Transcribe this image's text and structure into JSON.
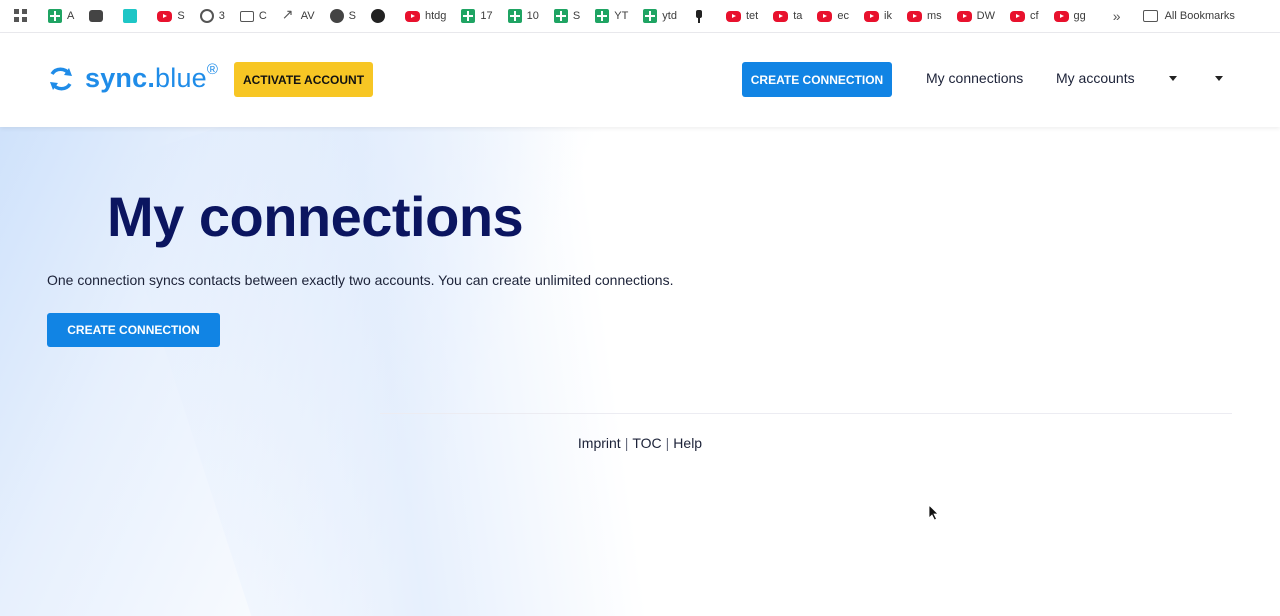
{
  "bookmarks": {
    "items": [
      {
        "icon": "sheets-icon",
        "label": "A"
      },
      {
        "icon": "puzzle-icon",
        "label": ""
      },
      {
        "icon": "cyan-app-icon",
        "label": ""
      },
      {
        "icon": "youtube-icon",
        "label": "S"
      },
      {
        "icon": "chatgpt-icon",
        "label": "3"
      },
      {
        "icon": "folder-icon",
        "label": "C"
      },
      {
        "icon": "trend-icon",
        "label": "AV"
      },
      {
        "icon": "globe-icon",
        "label": "S"
      },
      {
        "icon": "github-icon",
        "label": ""
      },
      {
        "icon": "youtube-icon",
        "label": "htdg"
      },
      {
        "icon": "sheets-icon",
        "label": "17"
      },
      {
        "icon": "sheets-icon",
        "label": "10"
      },
      {
        "icon": "sheets-icon",
        "label": "S"
      },
      {
        "icon": "sheets-icon",
        "label": "YT"
      },
      {
        "icon": "sheets-icon",
        "label": "ytd"
      },
      {
        "icon": "pin-icon",
        "label": ""
      },
      {
        "icon": "youtube-icon",
        "label": "tet"
      },
      {
        "icon": "youtube-icon",
        "label": "ta"
      },
      {
        "icon": "youtube-icon",
        "label": "ec"
      },
      {
        "icon": "youtube-icon",
        "label": "ik"
      },
      {
        "icon": "youtube-icon",
        "label": "ms"
      },
      {
        "icon": "youtube-icon",
        "label": "DW"
      },
      {
        "icon": "youtube-icon",
        "label": "cf"
      },
      {
        "icon": "youtube-icon",
        "label": "gg"
      }
    ],
    "overflow": "»",
    "all_bookmarks": "All Bookmarks"
  },
  "header": {
    "logo_text": "sync",
    "logo_dot": ".",
    "logo_suffix": "blue",
    "logo_reg": "®",
    "activate_label": "ACTIVATE ACCOUNT",
    "create_label": "CREATE CONNECTION",
    "nav_connections": "My connections",
    "nav_accounts": "My accounts"
  },
  "main": {
    "title": "My connections",
    "description": "One connection syncs contacts between exactly two accounts. You can create unlimited connections.",
    "create_label": "CREATE CONNECTION"
  },
  "footer": {
    "imprint": "Imprint",
    "toc": "TOC",
    "help": "Help",
    "separator": "|"
  },
  "colors": {
    "brand_blue": "#1184e4",
    "activate_yellow": "#f7c624",
    "title_navy": "#0b1560"
  }
}
